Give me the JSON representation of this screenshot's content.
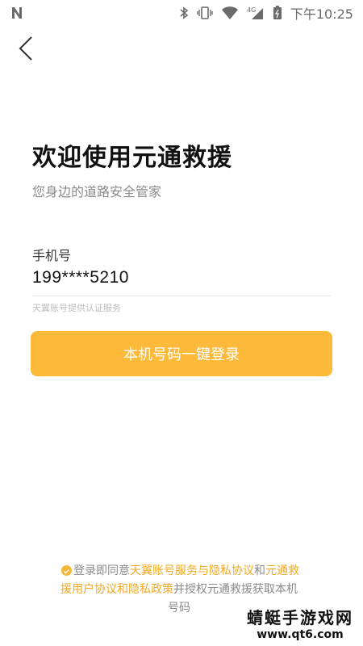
{
  "status_bar": {
    "notification_icon": "n-icon",
    "network_label": "4G",
    "time": "下午10:25",
    "icons": [
      "bluetooth-icon",
      "vibrate-icon",
      "wifi-icon",
      "signal-icon",
      "battery-icon"
    ]
  },
  "nav": {
    "back_icon": "chevron-left-icon"
  },
  "header": {
    "title": "欢迎使用元通救援",
    "subtitle": "您身边的道路安全管家"
  },
  "phone": {
    "label": "手机号",
    "value": "199****5210",
    "provider_note": "天翼账号提供认证服务"
  },
  "login_button": {
    "label": "本机号码一键登录"
  },
  "agreement": {
    "prefix": "登录即同意",
    "link_1": "天翼账号服务与隐私协议",
    "connector_1": "和",
    "link_2": "元通救援用户协议和隐私政策",
    "suffix": "并授权元通救援获取本机号码"
  },
  "watermark": {
    "main": "蜻蜓手游戏网",
    "sub": "www.qt6.com"
  },
  "colors": {
    "accent": "#fdb93a",
    "link": "#f1a925"
  }
}
